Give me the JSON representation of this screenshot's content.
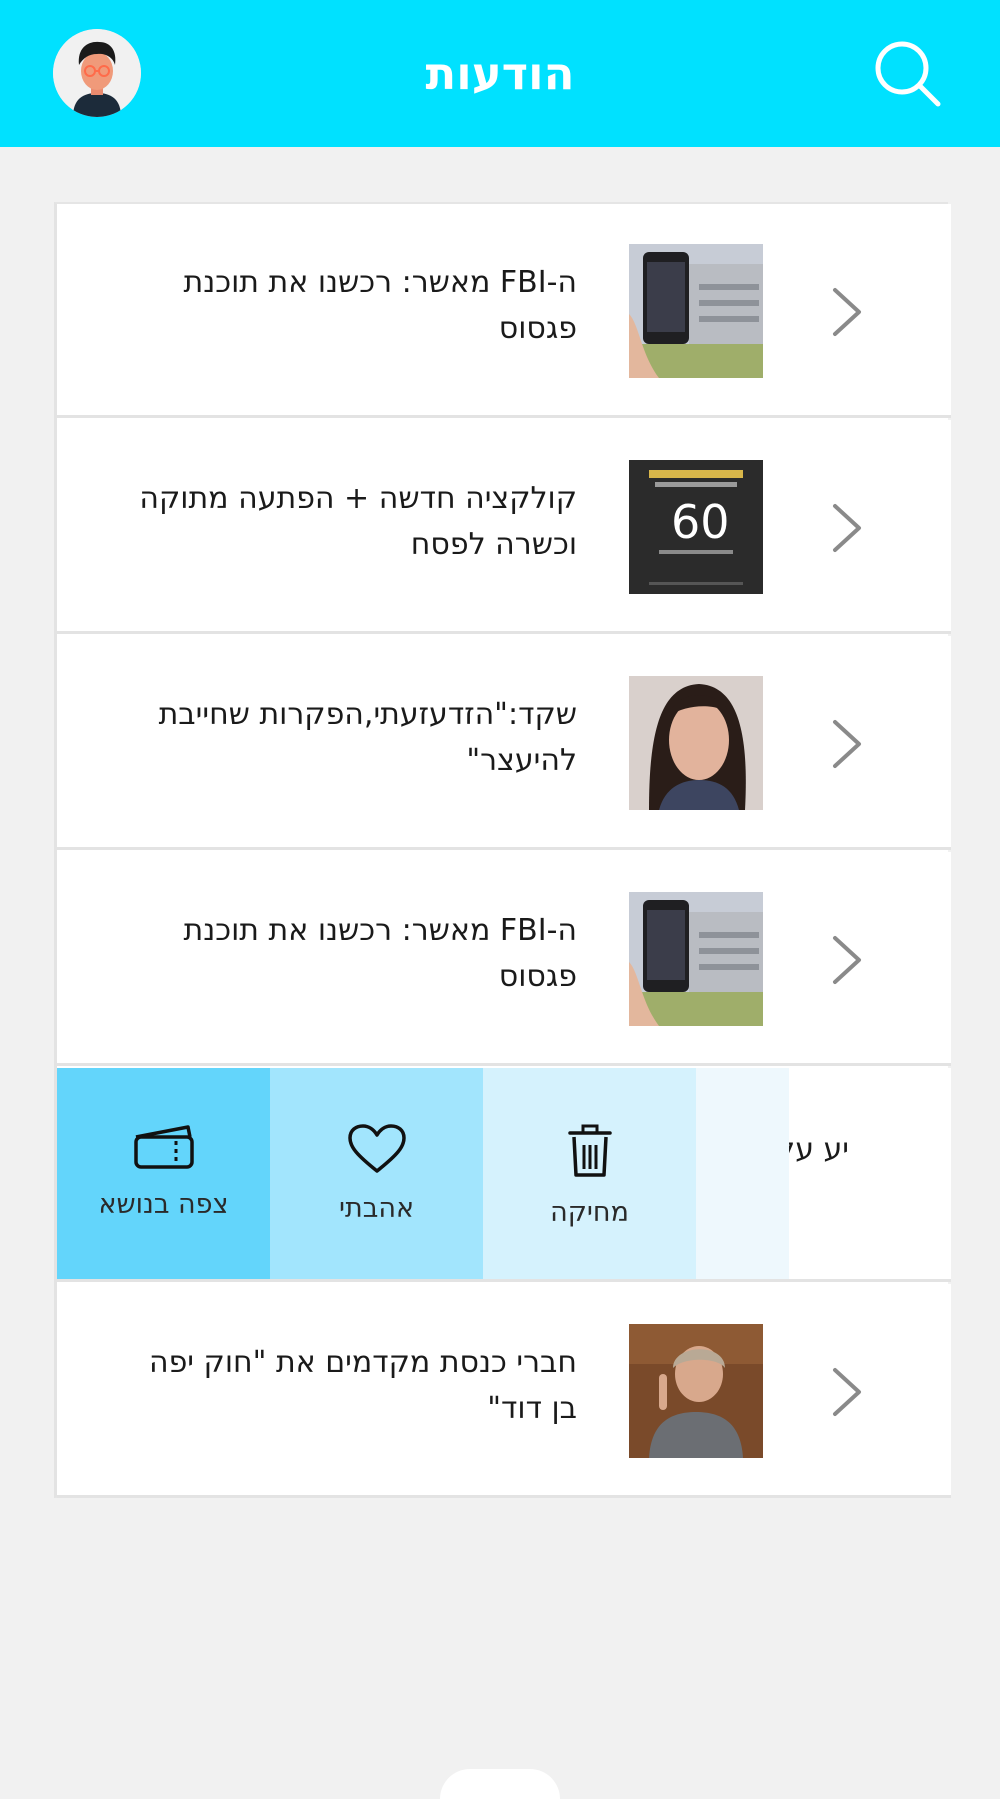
{
  "header": {
    "title": "הודעות",
    "avatar_icon": "avatar-icon",
    "search_icon": "search-icon"
  },
  "colors": {
    "accent": "#00e1ff",
    "action_follow": "#63d5fb",
    "action_like": "#a2e5fd",
    "action_delete": "#d5f2fd",
    "action_spacer": "#eef8fd"
  },
  "messages": [
    {
      "text": "ה-FBI מאשר: רכשנו את תוכנת פגסוס",
      "thumb": "phone-building-photo"
    },
    {
      "text": "קולקציה חדשה + הפתעה מתוקה וכשרה לפסח",
      "thumb": "sale-60-percent-ad",
      "thumb_text": "60"
    },
    {
      "text": "שקד:\"הזדעזעתי,הפקרות שחייבת להיעצר\"",
      "thumb": "woman-portrait-photo"
    },
    {
      "text": "ה-FBI מאשר: רכשנו את תוכנת פגסוס",
      "thumb": "phone-building-photo"
    },
    {
      "text": "חברי כנסת מקדמים את \"חוק יפה בן דוד\"",
      "thumb": "knesset-member-photo"
    }
  ],
  "swiped_row": {
    "peek_text": "יע על",
    "actions": [
      {
        "label": "צפה בנושא",
        "icon": "ticket-icon"
      },
      {
        "label": "אהבתי",
        "icon": "heart-icon"
      },
      {
        "label": "מחיקה",
        "icon": "trash-icon"
      }
    ]
  }
}
